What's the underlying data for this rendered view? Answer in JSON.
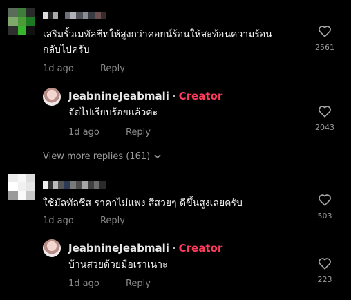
{
  "comments": [
    {
      "text_line1": "เสริมรั้วเมทัลชีทให้สูงกว่าคอยน์ร้อนให้สะท้อนความร้อน",
      "text_line2": "กลับไปครับ",
      "time": "1d ago",
      "reply_label": "Reply",
      "likes": "2561"
    },
    {
      "author": "JeabnineJeabmali",
      "separator": "·",
      "badge": "Creator",
      "text": "จัดไปเรียบร้อยแล้วค่ะ",
      "time": "1d ago",
      "reply_label": "Reply",
      "likes": "2043"
    },
    {
      "text": "ใช้มัลทัลชีส ราคาไม่แพง สีสวยๆ ดีขึ้นสูงเลยครับ",
      "time": "1d ago",
      "reply_label": "Reply",
      "likes": "503"
    },
    {
      "author": "JeabnineJeabmali",
      "separator": "·",
      "badge": "Creator",
      "text": "บ้านสวยด้วยมือเราเนาะ",
      "time": "1d ago",
      "reply_label": "Reply",
      "likes": "223"
    }
  ],
  "view_more": "View more replies (161)",
  "icons": {
    "like": "heart-outline-icon",
    "expand": "chevron-down-icon"
  },
  "colors": {
    "background": "#000000",
    "creator_badge": "#ff3b5c",
    "secondary_text": "#8a8a8a"
  }
}
